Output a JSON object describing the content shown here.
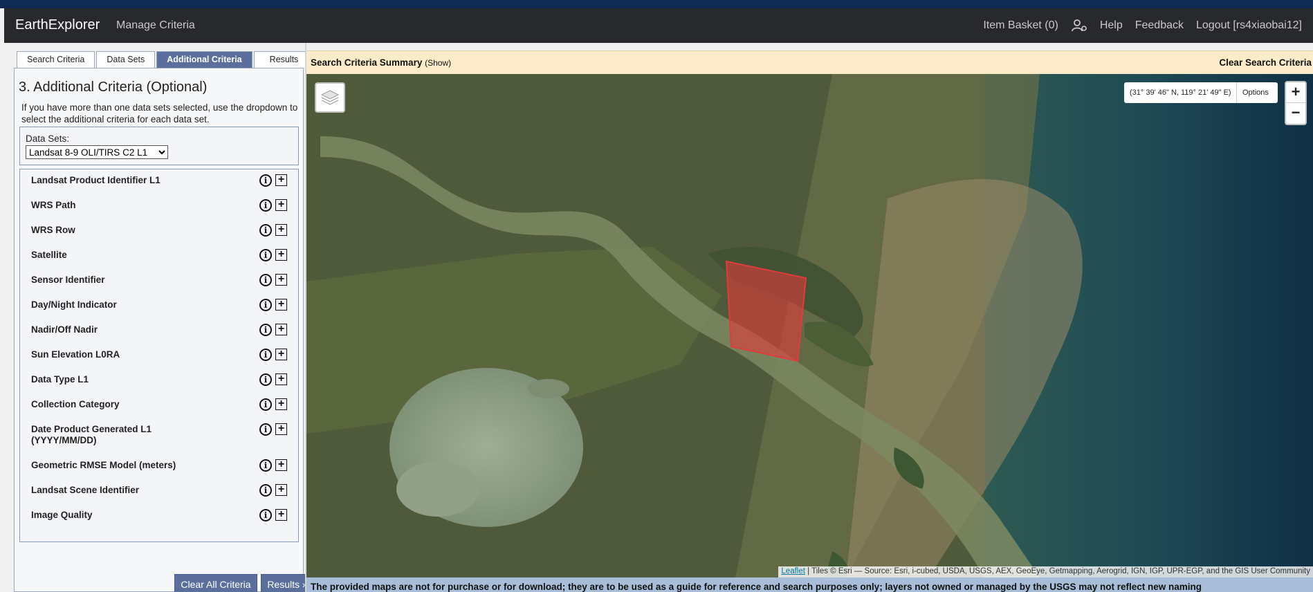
{
  "header": {
    "brand": "EarthExplorer",
    "manage": "Manage Criteria",
    "item_basket": "Item Basket (0)",
    "help": "Help",
    "feedback": "Feedback",
    "logout": "Logout [rs4xiaobai12]"
  },
  "tabs": [
    {
      "label": "Search Criteria"
    },
    {
      "label": "Data Sets"
    },
    {
      "label": "Additional Criteria",
      "active": true
    },
    {
      "label": "Results"
    }
  ],
  "panel": {
    "title": "3. Additional Criteria (Optional)",
    "help": "If you have more than one data sets selected, use the dropdown to select the additional criteria for each data set.",
    "datasets_label": "Data Sets:",
    "datasets_selected": "Landsat 8-9 OLI/TIRS C2 L1",
    "criteria": [
      {
        "name": "Landsat Product Identifier L1"
      },
      {
        "name": "WRS Path"
      },
      {
        "name": "WRS Row"
      },
      {
        "name": "Satellite"
      },
      {
        "name": "Sensor Identifier"
      },
      {
        "name": "Day/Night Indicator"
      },
      {
        "name": "Nadir/Off Nadir"
      },
      {
        "name": "Sun Elevation L0RA"
      },
      {
        "name": "Data Type L1"
      },
      {
        "name": "Collection Category"
      },
      {
        "name": "Date Product Generated L1 (YYYY/MM/DD)"
      },
      {
        "name": "Geometric RMSE Model (meters)"
      },
      {
        "name": "Landsat Scene Identifier"
      },
      {
        "name": "Image Quality"
      }
    ],
    "info_glyph": "i",
    "plus_glyph": "+",
    "clear_all": "Clear All Criteria",
    "results": "Results »"
  },
  "summary": {
    "title": "Search Criteria Summary",
    "show": "(Show)",
    "clear": "Clear Search Criteria"
  },
  "map": {
    "coords": "(31° 39' 46\" N, 119° 21' 49\" E)",
    "options": "Options",
    "zoom_in": "+",
    "zoom_out": "−",
    "attribution_link": "Leaflet",
    "attribution_text": " | Tiles © Esri — Source: Esri, i-cubed, USDA, USGS, AEX, GeoEye, Getmapping, Aerogrid, IGN, IGP, UPR-EGP, and the GIS User Community",
    "polygon_color": "#e23b3b"
  },
  "notice": "The provided maps are not for purchase or for download; they are to be used as a guide for reference and search purposes only; layers not owned or managed by the USGS may not reflect new naming"
}
